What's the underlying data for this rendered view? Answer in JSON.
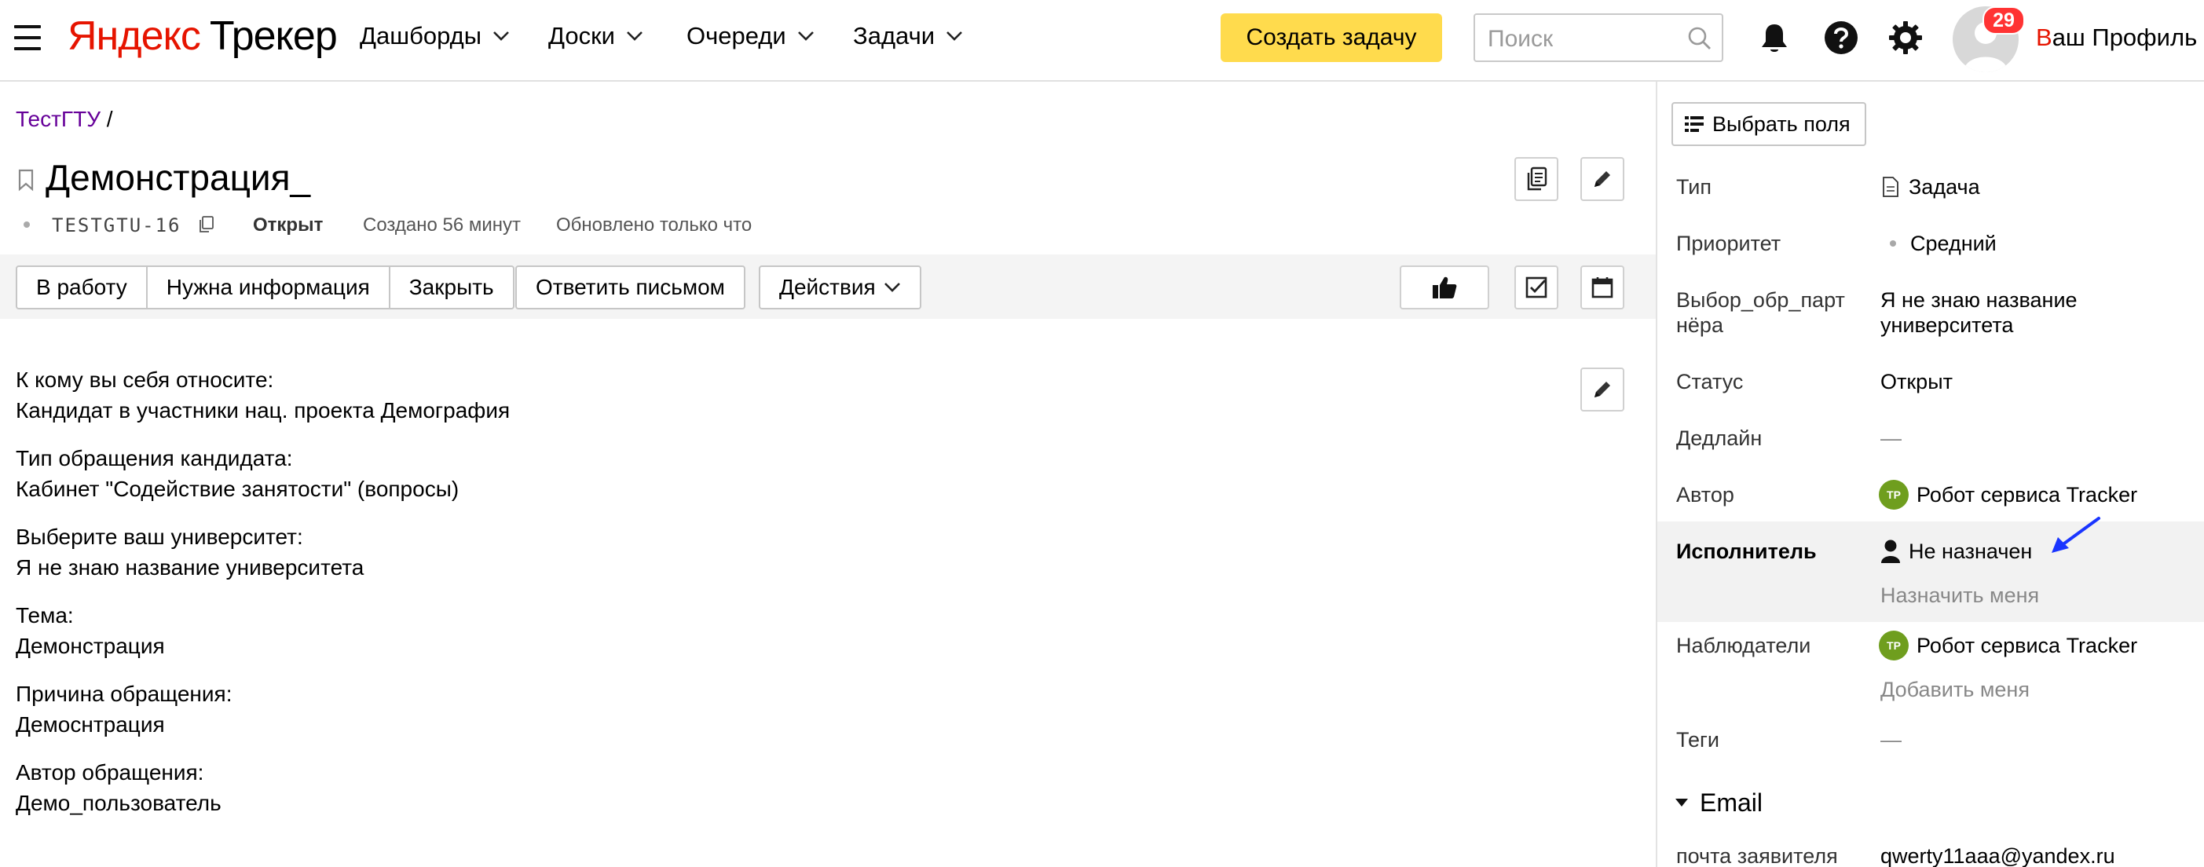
{
  "header": {
    "logo_yandex": "Яндекс",
    "logo_product": "Трекер",
    "nav": [
      "Дашборды",
      "Доски",
      "Очереди",
      "Задачи"
    ],
    "create_task": "Создать задачу",
    "search_placeholder": "Поиск",
    "notifications_count": "29",
    "profile_first_letter": "В",
    "profile_rest": "аш Профиль"
  },
  "breadcrumb": {
    "queue": "ТестГТУ",
    "separator": "/"
  },
  "issue": {
    "title": "Демонстрация_",
    "key": "TESTGTU-16",
    "status": "Открыт",
    "created": "Создано 56 минут",
    "updated": "Обновлено только что"
  },
  "actions": {
    "in_work": "В работу",
    "need_info": "Нужна информация",
    "close": "Закрыть",
    "reply_email": "Ответить письмом",
    "actions": "Действия"
  },
  "description": [
    {
      "label": "К кому вы себя относите:",
      "value": "Кандидат в участники нац. проекта Демография"
    },
    {
      "label": "Тип обращения кандидата:",
      "value": "Кабинет \"Содействие занятости\" (вопросы)"
    },
    {
      "label": "Выберите ваш университет:",
      "value": "Я не знаю название университета"
    },
    {
      "label": "Тема:",
      "value": "Демонстрация"
    },
    {
      "label": "Причина обращения:",
      "value": "Демоснтрация"
    },
    {
      "label": "Автор обращения:",
      "value": "Демо_пользователь"
    }
  ],
  "sidebar": {
    "choose_fields": "Выбрать поля",
    "type_label": "Тип",
    "type_value": "Задача",
    "priority_label": "Приоритет",
    "priority_value": "Средний",
    "partner_label_line1": "Выбор_обр_парт",
    "partner_label_line2": "нёра",
    "partner_value_line1": "Я не знаю название",
    "partner_value_line2": "университета",
    "status_label": "Статус",
    "status_value": "Открыт",
    "deadline_label": "Дедлайн",
    "deadline_value": "—",
    "author_label": "Автор",
    "author_initials": "ТР",
    "author_value": "Робот сервиса Tracker",
    "assignee_label": "Исполнитель",
    "assignee_value": "Не назначен",
    "assign_me": "Назначить меня",
    "followers_label": "Наблюдатели",
    "follower_initials": "ТР",
    "follower_value": "Робот сервиса Tracker",
    "add_me": "Добавить меня",
    "tags_label": "Теги",
    "tags_value": "—",
    "email_section": "Email",
    "applicant_email_label": "почта заявителя",
    "applicant_email_value": "qwerty11aaa@yandex.ru"
  },
  "colors": {
    "brand_red": "#e61400",
    "create_button": "#ffdb4d",
    "link_purple": "#660099",
    "badge_red": "#ff3333",
    "robot_avatar": "#6f9e1e",
    "annotation_arrow": "#1a35ff"
  },
  "icons": [
    "menu-icon",
    "chevron-down-icon",
    "search-icon",
    "bell-icon",
    "help-icon",
    "gear-icon",
    "avatar-icon",
    "bookmark-icon",
    "copy-icon",
    "pencil-icon",
    "thumbs-up-icon",
    "checkbox-icon",
    "calendar-icon",
    "fields-icon",
    "document-icon",
    "person-icon",
    "triangle-down-icon",
    "arrow-annotation-icon"
  ]
}
